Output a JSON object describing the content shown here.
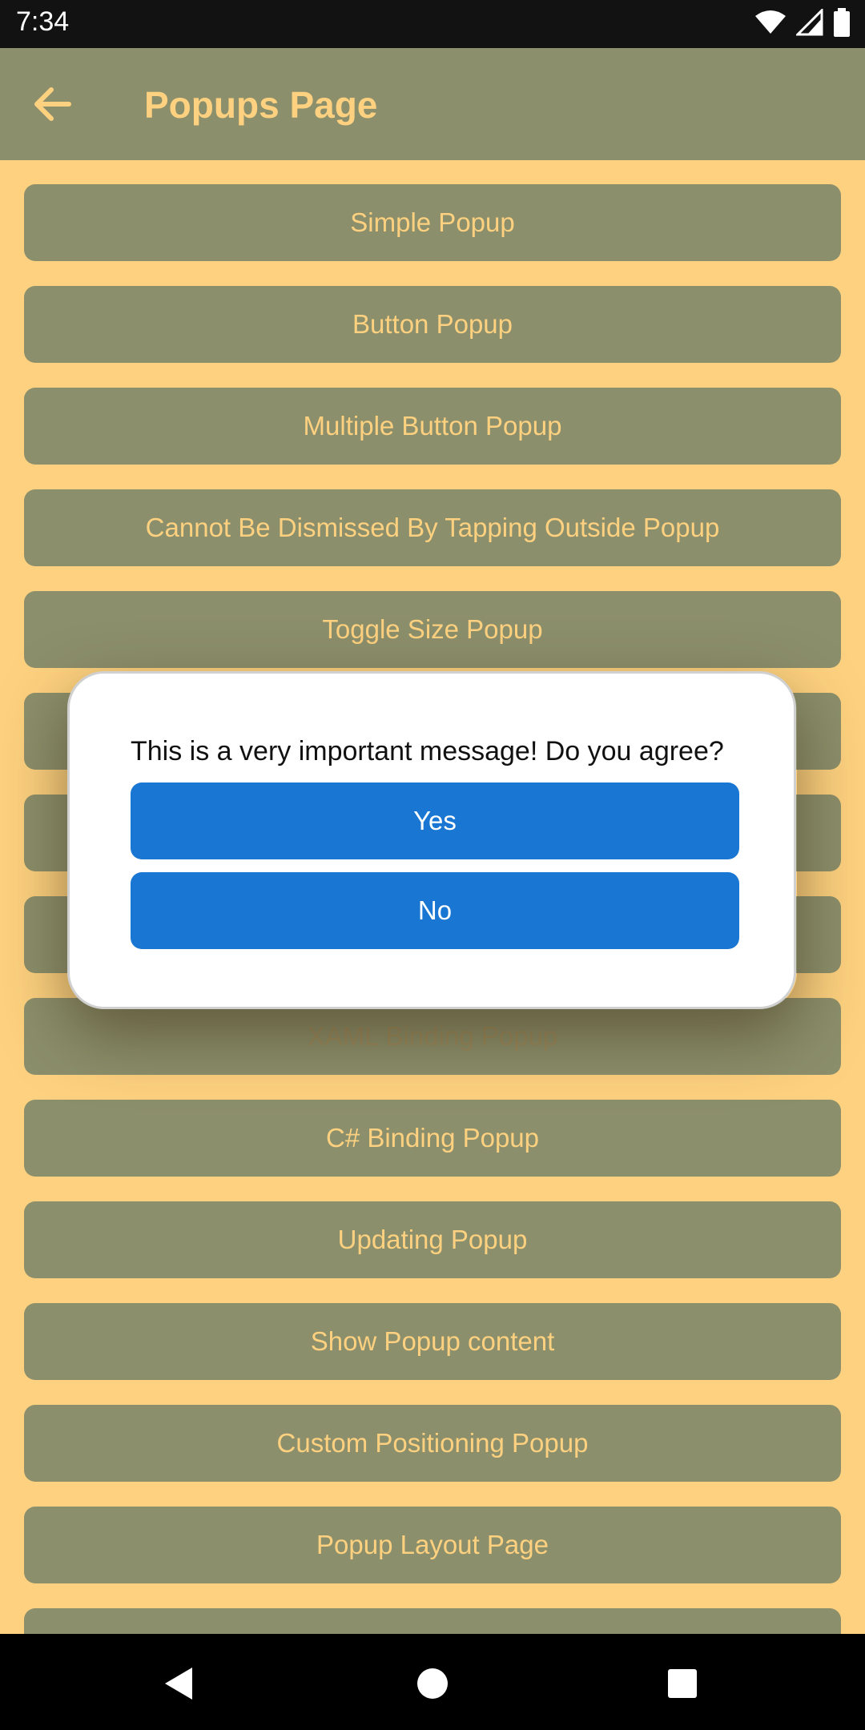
{
  "status_bar": {
    "time": "7:34",
    "icons": [
      "wifi-icon",
      "signal-icon",
      "battery-icon"
    ]
  },
  "app_bar": {
    "title": "Popups Page",
    "back_icon": "arrow-left-icon"
  },
  "buttons": [
    "Simple Popup",
    "Button Popup",
    "Multiple Button Popup",
    "Cannot Be Dismissed By Tapping Outside Popup",
    "Toggle Size Popup",
    "",
    "",
    "",
    "XAML Binding Popup",
    "C# Binding Popup",
    "Updating Popup",
    "Show Popup content",
    "Custom Positioning Popup",
    "Popup Layout Page"
  ],
  "popup": {
    "message": "This is a very important message! Do you agree?",
    "yes_label": "Yes",
    "no_label": "No"
  },
  "colors": {
    "background": "#FDD17F",
    "bar": "#8C8F6B",
    "accent": "#1976D2",
    "status_bar": "#121212"
  },
  "nav_bar": {
    "icons": [
      "back-triangle-icon",
      "home-circle-icon",
      "recents-square-icon"
    ]
  }
}
